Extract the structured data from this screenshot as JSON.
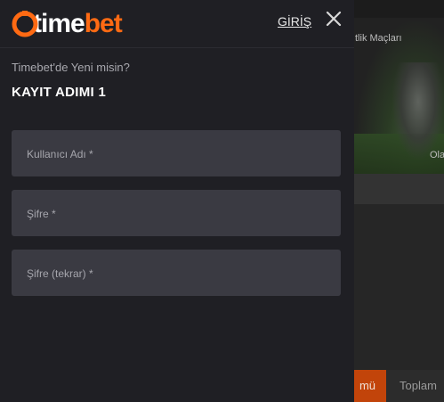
{
  "background": {
    "banner_title": "tlik Maçları",
    "banner_side_text": "Ola",
    "bottom_tabs": [
      {
        "label": "mü",
        "color": "#c2440a"
      },
      {
        "label": "Toplam"
      }
    ]
  },
  "drawer": {
    "logo": {
      "text_white": "time",
      "text_accent": "bet",
      "accent_color": "#ff6a13",
      "icon": "timebet-logo-icon"
    },
    "login_label": "GİRİŞ",
    "close_icon": "close-icon",
    "subtitle": "Timebet'de Yeni misin?",
    "step_title": "KAYIT ADIMI 1",
    "fields": [
      {
        "name": "username",
        "placeholder": "Kullanıcı Adı *",
        "value": ""
      },
      {
        "name": "password",
        "placeholder": "Şifre *",
        "value": ""
      },
      {
        "name": "password_repeat",
        "placeholder": "Şifre (tekrar) *",
        "value": ""
      }
    ]
  }
}
